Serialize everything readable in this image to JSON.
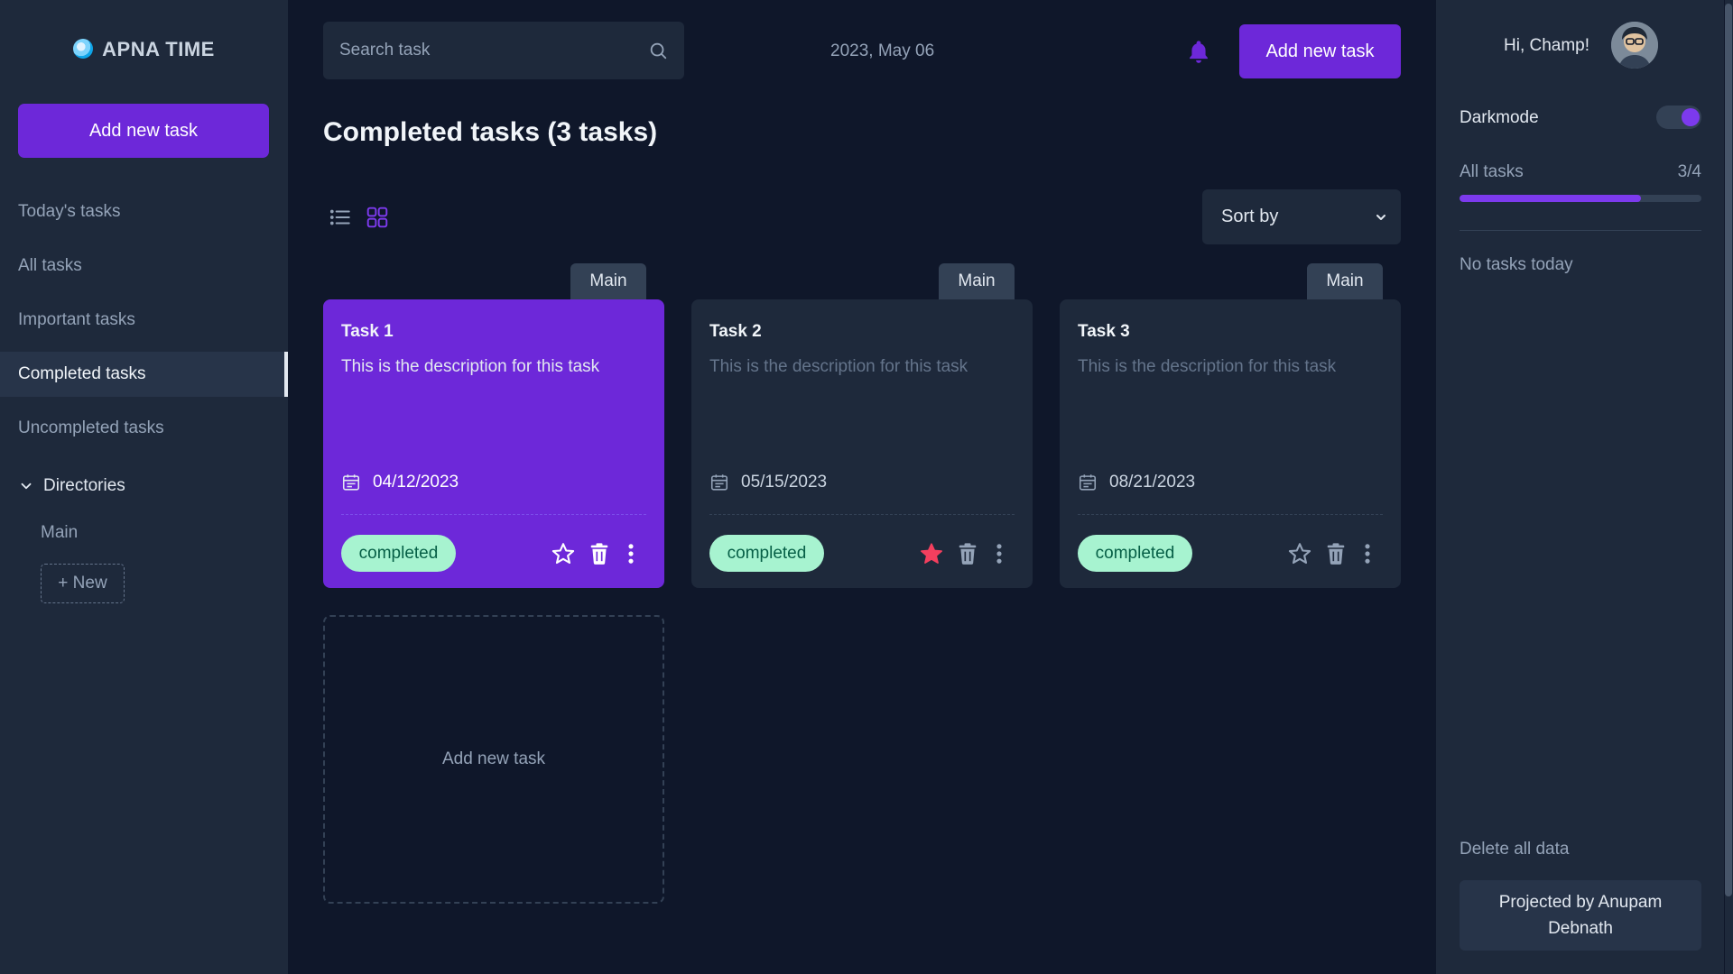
{
  "app": {
    "title": "APNA TIME"
  },
  "sidebar": {
    "add_label": "Add new task",
    "items": [
      {
        "label": "Today's tasks",
        "active": false
      },
      {
        "label": "All tasks",
        "active": false
      },
      {
        "label": "Important tasks",
        "active": false
      },
      {
        "label": "Completed tasks",
        "active": true
      },
      {
        "label": "Uncompleted tasks",
        "active": false
      }
    ],
    "directories_label": "Directories",
    "directory_items": [
      "Main"
    ],
    "new_directory_label": "+ New"
  },
  "header": {
    "search_placeholder": "Search task",
    "date": "2023, May 06",
    "add_label": "Add new task"
  },
  "main": {
    "title": "Completed tasks (3 tasks)",
    "sort_label": "Sort by",
    "view_mode": "grid",
    "add_card_label": "Add new task",
    "tasks": [
      {
        "dir": "Main",
        "title": "Task 1",
        "description": "This is the description for this task",
        "date": "04/12/2023",
        "status": "completed",
        "important": false
      },
      {
        "dir": "Main",
        "title": "Task 2",
        "description": "This is the description for this task",
        "date": "05/15/2023",
        "status": "completed",
        "important": true
      },
      {
        "dir": "Main",
        "title": "Task 3",
        "description": "This is the description for this task",
        "date": "08/21/2023",
        "status": "completed",
        "important": false
      }
    ]
  },
  "right_panel": {
    "greeting": "Hi, Champ!",
    "darkmode_label": "Darkmode",
    "darkmode_on": true,
    "all_tasks_label": "All tasks",
    "all_tasks_count": "3/4",
    "progress_fraction": 0.75,
    "no_tasks_label": "No tasks today",
    "delete_all_label": "Delete all data",
    "credit": "Projected by Anupam Debnath"
  },
  "colors": {
    "accent": "#6d28d9",
    "background": "#0f172a",
    "panel": "#1e293b",
    "badge_bg": "#a7f3d0",
    "star_active": "#f43f5e"
  },
  "icons": [
    "logo-icon",
    "search-icon",
    "bell-icon",
    "list-view-icon",
    "grid-view-icon",
    "chevron-down-icon",
    "calendar-icon",
    "star-icon",
    "trash-icon",
    "more-vertical-icon"
  ]
}
